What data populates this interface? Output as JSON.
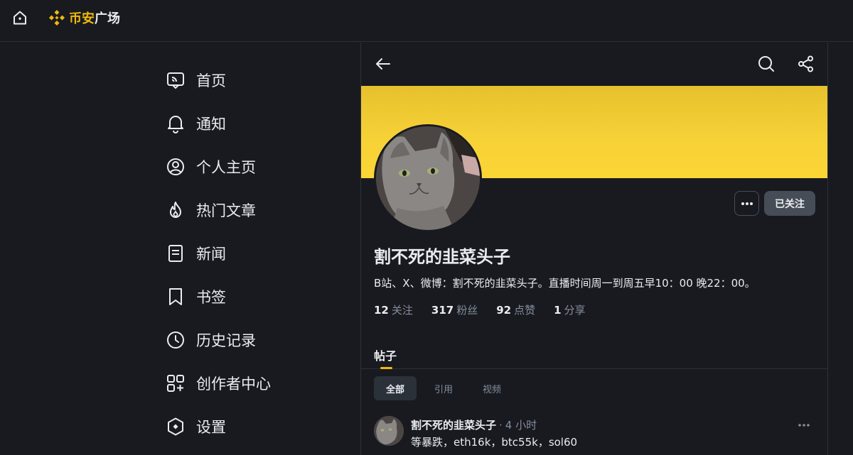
{
  "brand": {
    "part1": "币安",
    "part2": "广场",
    "color": "#f0b90b"
  },
  "nav": {
    "items": [
      {
        "label": "首页",
        "icon": "home-feed-icon"
      },
      {
        "label": "通知",
        "icon": "bell-icon"
      },
      {
        "label": "个人主页",
        "icon": "user-circle-icon"
      },
      {
        "label": "热门文章",
        "icon": "fire-icon"
      },
      {
        "label": "新闻",
        "icon": "news-icon"
      },
      {
        "label": "书签",
        "icon": "bookmark-icon"
      },
      {
        "label": "历史记录",
        "icon": "clock-icon"
      },
      {
        "label": "创作者中心",
        "icon": "grid-icon"
      },
      {
        "label": "设置",
        "icon": "settings-icon"
      }
    ]
  },
  "profile": {
    "name": "割不死的韭菜头子",
    "bio": "B站、X、微博：割不死的韭菜头子。直播时间周一到周五早10：00 晚22：00。",
    "follow_label": "已关注",
    "stats": [
      {
        "num": "12",
        "label": "关注"
      },
      {
        "num": "317",
        "label": "粉丝"
      },
      {
        "num": "92",
        "label": "点赞"
      },
      {
        "num": "1",
        "label": "分享"
      }
    ],
    "banner_color": "#fcd535"
  },
  "tabs": {
    "posts_label": "帖子"
  },
  "filters": [
    "全部",
    "引用",
    "视频"
  ],
  "post": {
    "author": "割不死的韭菜头子",
    "separator": "·",
    "time": "4 小时",
    "body": "等暴跌，eth16k，btc55k，sol60"
  }
}
